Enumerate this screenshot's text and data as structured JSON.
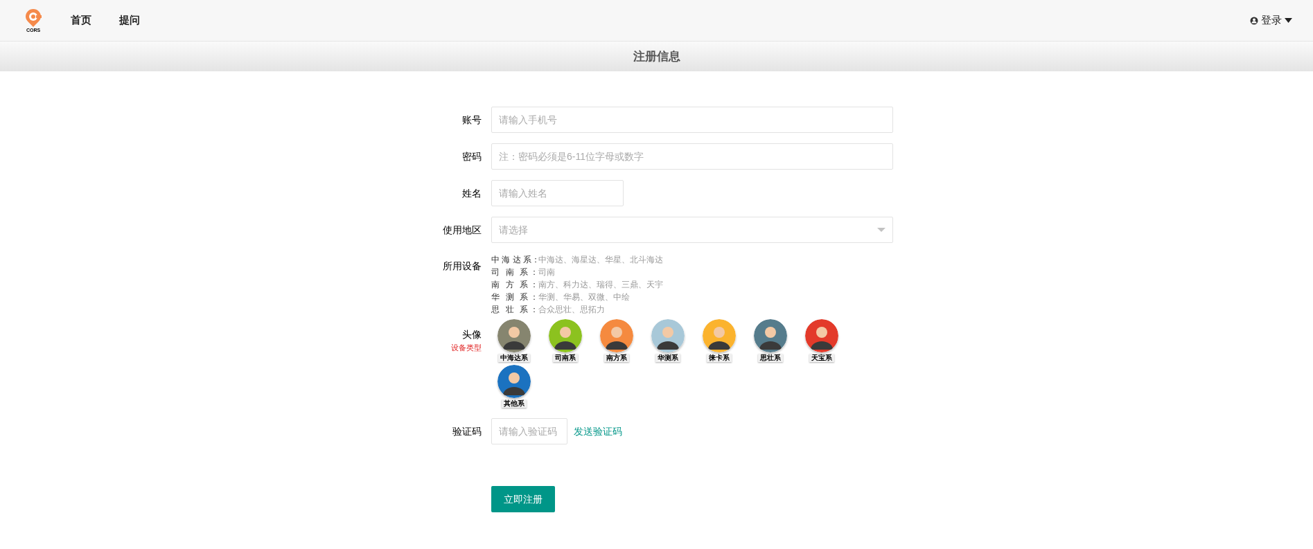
{
  "nav": {
    "logo_text": "CORS",
    "links": [
      {
        "label": "首页"
      },
      {
        "label": "提问"
      }
    ],
    "login": "登录"
  },
  "page_title": "注册信息",
  "form": {
    "account": {
      "label": "账号",
      "placeholder": "请输入手机号"
    },
    "password": {
      "label": "密码",
      "placeholder": "注：密码必须是6-11位字母或数字"
    },
    "name": {
      "label": "姓名",
      "placeholder": "请输入姓名"
    },
    "region": {
      "label": "使用地区",
      "placeholder": "请选择"
    },
    "devices": {
      "label": "所用设备",
      "items": [
        {
          "series": "中 海 达 系：",
          "brands": "中海达、海星达、华星、北斗海达"
        },
        {
          "series": "司 南 系：",
          "brands": "司南"
        },
        {
          "series": "南 方 系：",
          "brands": "南方、科力达、瑞得、三鼎、天宇"
        },
        {
          "series": "华 测 系：",
          "brands": "华测、华易、双微、中绘"
        },
        {
          "series": "思 壮 系：",
          "brands": "合众思壮、思拓力"
        }
      ]
    },
    "avatar": {
      "label": "头像",
      "sublabel": "设备类型",
      "options": [
        {
          "label": "中海达系",
          "color": "#86856f"
        },
        {
          "label": "司南系",
          "color": "#8cc21f"
        },
        {
          "label": "南方系",
          "color": "#f58a3f"
        },
        {
          "label": "华测系",
          "color": "#a8c8d8"
        },
        {
          "label": "徕卡系",
          "color": "#fbb32e"
        },
        {
          "label": "思壮系",
          "color": "#557c8c"
        },
        {
          "label": "天宝系",
          "color": "#e33a2a"
        },
        {
          "label": "其他系",
          "color": "#1b72c0"
        }
      ]
    },
    "captcha": {
      "label": "验证码",
      "placeholder": "请输入验证码",
      "send": "发送验证码"
    },
    "submit": "立即注册"
  }
}
